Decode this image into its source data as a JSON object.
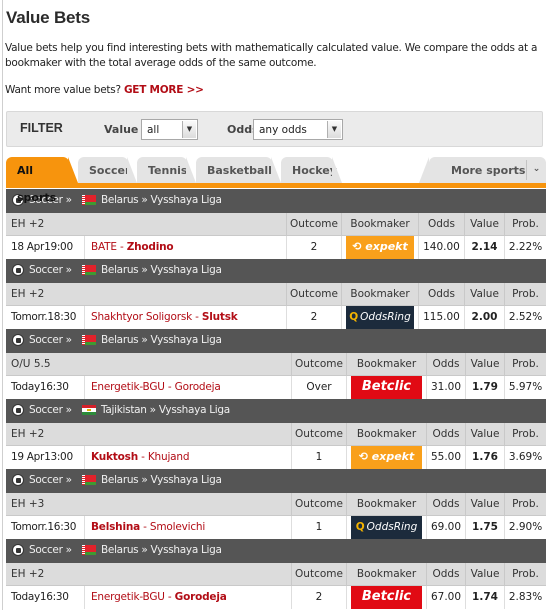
{
  "page": {
    "title": "Value Bets",
    "intro": "Value bets help you find interesting bets with mathematically calculated value. We compare the odds at a bookmaker with the total average odds of the same outcome.",
    "want_more_text": "Want more value bets?",
    "get_more_link": "GET MORE >>"
  },
  "filter": {
    "title": "FILTER",
    "value_label": "Value",
    "value_selected": "all",
    "odds_label": "Odds",
    "odds_selected": "any odds"
  },
  "tabs": {
    "items": [
      "All sports",
      "Soccer",
      "Tennis",
      "Basketball",
      "Hockey"
    ],
    "active": "All sports",
    "more_label": "More sports"
  },
  "columns": {
    "outcome": "Outcome",
    "bookmaker": "Bookmaker",
    "odds": "Odds",
    "value": "Value",
    "prob": "Prob."
  },
  "bets": [
    {
      "sport": "Soccer »",
      "country_flag": "belarus",
      "league": "Belarus » Vysshaya Liga",
      "market": "EH +2",
      "time": "18 Apr19:00",
      "home": "BATE",
      "away": "Zhodino",
      "bold_team": "away",
      "outcome": "2",
      "bookmaker": "expekt",
      "odds": "140.00",
      "value": "2.14",
      "prob": "2.22%"
    },
    {
      "sport": "Soccer »",
      "country_flag": "belarus",
      "league": "Belarus » Vysshaya Liga",
      "market": "EH +2",
      "time": "Tomorr.18:30",
      "home": "Shakhtyor Soligorsk",
      "away": "Slutsk",
      "bold_team": "away",
      "outcome": "2",
      "bookmaker": "OddsRing",
      "odds": "115.00",
      "value": "2.00",
      "prob": "2.52%"
    },
    {
      "sport": "Soccer »",
      "country_flag": "belarus",
      "league": "Belarus » Vysshaya Liga",
      "market": "O/U 5.5",
      "time": "Today16:30",
      "home": "Energetik-BGU",
      "away": "Gorodeja",
      "bold_team": "none",
      "outcome": "Over",
      "bookmaker": "Betclic",
      "odds": "31.00",
      "value": "1.79",
      "prob": "5.97%"
    },
    {
      "sport": "Soccer »",
      "country_flag": "tajikistan",
      "league": "Tajikistan » Vysshaya Liga",
      "market": "EH +2",
      "time": "19 Apr13:00",
      "home": "Kuktosh",
      "away": "Khujand",
      "bold_team": "home",
      "outcome": "1",
      "bookmaker": "expekt",
      "odds": "55.00",
      "value": "1.76",
      "prob": "3.69%"
    },
    {
      "sport": "Soccer »",
      "country_flag": "belarus",
      "league": "Belarus » Vysshaya Liga",
      "market": "EH +3",
      "time": "Tomorr.16:30",
      "home": "Belshina",
      "away": "Smolevichi",
      "bold_team": "home",
      "outcome": "1",
      "bookmaker": "OddsRing",
      "odds": "69.00",
      "value": "1.75",
      "prob": "2.90%"
    },
    {
      "sport": "Soccer »",
      "country_flag": "belarus",
      "league": "Belarus » Vysshaya Liga",
      "market": "EH +2",
      "time": "Today16:30",
      "home": "Energetik-BGU",
      "away": "Gorodeja",
      "bold_team": "away",
      "outcome": "2",
      "bookmaker": "Betclic",
      "odds": "67.00",
      "value": "1.74",
      "prob": "2.83%"
    }
  ],
  "colors": {
    "accent_orange": "#f7940d",
    "link_red": "#b20d16",
    "header_dark": "#555555",
    "expekt": "#f9a01b",
    "oddsring": "#1c2b3c",
    "betclic": "#e10a14"
  },
  "icons": {
    "sport": "soccer-ball-icon",
    "dropdown": "chevron-down-icon"
  }
}
